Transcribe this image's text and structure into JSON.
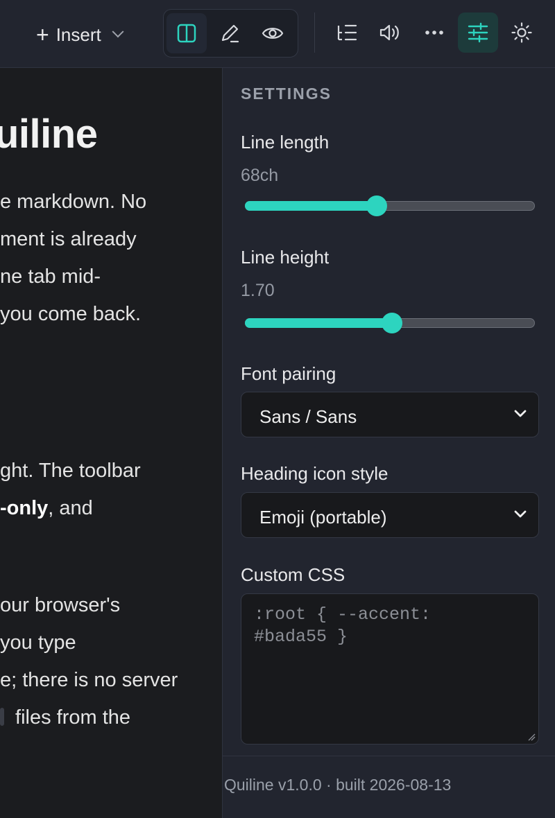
{
  "toolbar": {
    "insert_label": "Insert",
    "icons": [
      "plus-icon",
      "chevron-down-icon",
      "split-view-icon",
      "edit-pencil-icon",
      "preview-eye-icon",
      "outline-icon",
      "read-aloud-icon",
      "more-icon",
      "settings-sliders-icon",
      "theme-sun-icon"
    ],
    "active_mode": "split",
    "accent_color": "#2dd4bf"
  },
  "editor": {
    "title": "uiline",
    "paragraphs": [
      [
        "e markdown. No",
        "ment is already",
        "ne tab mid-",
        "you come back."
      ],
      [
        "ght. The toolbar",
        {
          "bold": "-only",
          "rest": ", and"
        }
      ],
      [
        "our browser's",
        " you type",
        "e; there is no server",
        " files from the"
      ]
    ]
  },
  "settings": {
    "title": "SETTINGS",
    "line_length": {
      "label": "Line length",
      "value": "68ch",
      "fraction": 0.455
    },
    "line_height": {
      "label": "Line height",
      "value": "1.70",
      "fraction": 0.506
    },
    "font_pairing": {
      "label": "Font pairing",
      "selected": "Sans / Sans"
    },
    "heading_icon_style": {
      "label": "Heading icon style",
      "selected": "Emoji (portable)"
    },
    "custom_css": {
      "label": "Custom CSS",
      "placeholder": ":root { --accent: #bada55 }"
    }
  },
  "footer": {
    "text": "Quiline v1.0.0 · built 2026-08-13"
  }
}
